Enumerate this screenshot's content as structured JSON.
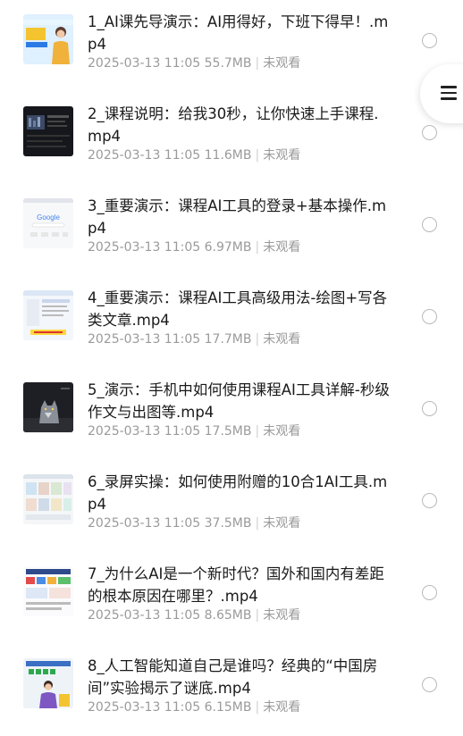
{
  "files": [
    {
      "title": "1_AI课先导演示：AI用得好，下班下得早！.mp4",
      "date": "2025-03-13 11:05",
      "size": "55.7MB",
      "status": "未观看",
      "thumb": "thumb-presenter-icon"
    },
    {
      "title": "2_课程说明：给我30秒，让你快速上手课程.mp4",
      "date": "2025-03-13 11:05",
      "size": "11.6MB",
      "status": "未观看",
      "thumb": "thumb-dark-screen-icon"
    },
    {
      "title": "3_重要演示：课程AI工具的登录+基本操作.mp4",
      "date": "2025-03-13 11:05",
      "size": "6.97MB",
      "status": "未观看",
      "thumb": "thumb-google-page-icon"
    },
    {
      "title": "4_重要演示：课程AI工具高级用法-绘图+写各类文章.mp4",
      "date": "2025-03-13 11:05",
      "size": "17.7MB",
      "status": "未观看",
      "thumb": "thumb-web-page-icon"
    },
    {
      "title": "5_演示：手机中如何使用课程AI工具详解-秒级作文与出图等.mp4",
      "date": "2025-03-13 11:05",
      "size": "17.5MB",
      "status": "未观看",
      "thumb": "thumb-wolf-image-icon"
    },
    {
      "title": "6_录屏实操：如何使用附赠的10合1AI工具.mp4",
      "date": "2025-03-13 11:05",
      "size": "37.5MB",
      "status": "未观看",
      "thumb": "thumb-gallery-icon"
    },
    {
      "title": "7_为什么AI是一个新时代？国外和国内有差距的根本原因在哪里？.mp4",
      "date": "2025-03-13 11:05",
      "size": "8.65MB",
      "status": "未观看",
      "thumb": "thumb-infographic-icon"
    },
    {
      "title": "8_人工智能知道自己是谁吗？经典的“中国房间”实验揭示了谜底.mp4",
      "date": "2025-03-13 11:05",
      "size": "6.15MB",
      "status": "未观看",
      "thumb": "thumb-slide-presenter-icon"
    }
  ],
  "menu_button": {
    "icon": "hamburger-menu-icon"
  },
  "colors": {
    "title": "#1a1a1a",
    "meta": "#9a9a9a",
    "radio": "#b9b9b9"
  }
}
